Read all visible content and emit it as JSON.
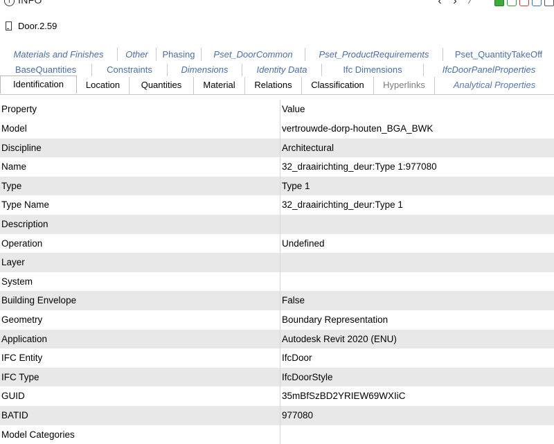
{
  "panel": {
    "title": "INFO"
  },
  "object": {
    "name": "Door.2.59"
  },
  "tabs": {
    "row1": [
      {
        "label": "Materials and Finishes",
        "italic": true
      },
      {
        "label": "Other",
        "italic": true
      },
      {
        "label": "Phasing",
        "italic": false
      },
      {
        "label": "Pset_DoorCommon",
        "italic": true
      },
      {
        "label": "Pset_ProductRequirements",
        "italic": true
      },
      {
        "label": "Pset_QuantityTakeOff",
        "italic": false
      }
    ],
    "row2": [
      {
        "label": "BaseQuantities",
        "italic": false
      },
      {
        "label": "Constraints",
        "italic": false
      },
      {
        "label": "Dimensions",
        "italic": true
      },
      {
        "label": "Identity Data",
        "italic": true
      },
      {
        "label": "Ifc Dimensions",
        "italic": false
      },
      {
        "label": "IfcDoorPanelProperties",
        "italic": true
      }
    ],
    "row3": [
      {
        "label": "Identification",
        "state": "active"
      },
      {
        "label": "Location",
        "state": "normal"
      },
      {
        "label": "Quantities",
        "state": "normal"
      },
      {
        "label": "Material",
        "state": "normal"
      },
      {
        "label": "Relations",
        "state": "normal"
      },
      {
        "label": "Classification",
        "state": "normal"
      },
      {
        "label": "Hyperlinks",
        "state": "disabled"
      },
      {
        "label": "Analytical Properties",
        "state": "italic"
      }
    ]
  },
  "grid": {
    "header": {
      "property": "Property",
      "value": "Value"
    },
    "rows": [
      {
        "property": "Model",
        "value": "vertrouwde-dorp-houten_BGA_BWK"
      },
      {
        "property": "Discipline",
        "value": "Architectural"
      },
      {
        "property": "Name",
        "value": "32_draairichting_deur:Type 1:977080"
      },
      {
        "property": "Type",
        "value": "Type 1"
      },
      {
        "property": "Type Name",
        "value": "32_draairichting_deur:Type 1"
      },
      {
        "property": "Description",
        "value": ""
      },
      {
        "property": "Operation",
        "value": "Undefined"
      },
      {
        "property": "Layer",
        "value": ""
      },
      {
        "property": "System",
        "value": ""
      },
      {
        "property": "Building Envelope",
        "value": "False"
      },
      {
        "property": "Geometry",
        "value": "Boundary Representation"
      },
      {
        "property": "Application",
        "value": "Autodesk Revit 2020 (ENU)"
      },
      {
        "property": "IFC Entity",
        "value": "IfcDoor"
      },
      {
        "property": "IFC Type",
        "value": "IfcDoorStyle"
      },
      {
        "property": "GUID",
        "value": "35mBfSzBD2YRIEW69WXIiC"
      },
      {
        "property": "BATID",
        "value": "977080"
      },
      {
        "property": "Model Categories",
        "value": ""
      }
    ]
  },
  "colors": {
    "tab_link": "#4a6ea8",
    "row_alt": "#e8e8e8",
    "cube_green": "#3fa83f",
    "close_red": "#d43535"
  },
  "icons": [
    "info-icon",
    "back-icon",
    "forward-icon",
    "cube-icon",
    "green-square-icon",
    "red-square-icon",
    "blue-square-icon",
    "window-icon",
    "door-icon"
  ]
}
